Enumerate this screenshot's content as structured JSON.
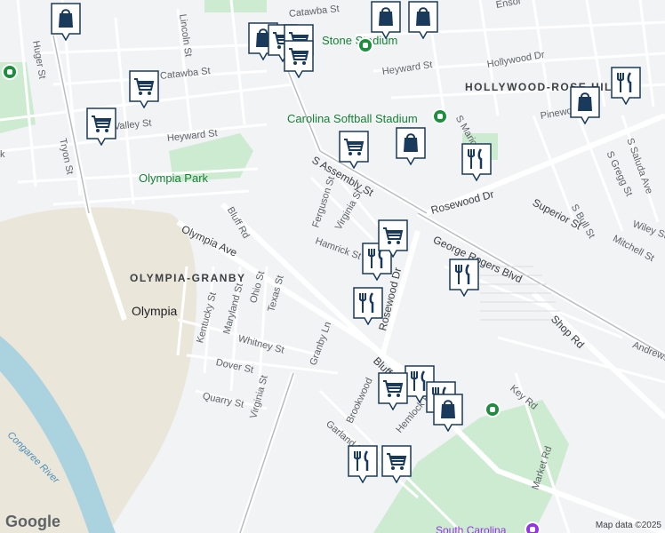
{
  "neighborhoods": [
    {
      "name": "OLYMPIA-GRANBY"
    },
    {
      "name": "HOLLYWOOD-ROSE HILL"
    }
  ],
  "city_label": "Olympia",
  "parks": [
    {
      "name": "Olympia Park"
    },
    {
      "name": "Carolina Softball Stadium"
    },
    {
      "name": "Stone Stadium"
    },
    {
      "name": "South Carolina"
    }
  ],
  "water": [
    {
      "name": "Congaree River"
    }
  ],
  "streets": [
    "Huger St",
    "Lincoln St",
    "Tryon St",
    "Heyward St",
    "S Assembly St",
    "Ferguson St",
    "Virginia St",
    "Hamrick St",
    "Bluff Rd",
    "Olympia Ave",
    "Ohio St",
    "Texas St",
    "Maryland St",
    "Kentucky St",
    "Whitney St",
    "Dover St",
    "Quarry St",
    "Virginia St",
    "Granby Ln",
    "Rosewood Dr",
    "Rosewood Dr",
    "George Rogers Blvd",
    "Superior St",
    "S Bull St",
    "S Gregg St",
    "S Saluda Ave",
    "Mitchell St",
    "Shop Rd",
    "Andrews",
    "Key Rd",
    "Market Rd",
    "Garland St",
    "Brookwood",
    "Hemlock Rd",
    "Heyward St",
    "Hollywood Dr",
    "S Marion St",
    "Pinewood",
    "Wiley St",
    "Catawba St",
    "Catawba St",
    "Ensor",
    "Valley St",
    "Bluff",
    "Bluff"
  ],
  "markers": [
    {
      "type": "shopping-bag"
    },
    {
      "type": "shopping-bag"
    },
    {
      "type": "shopping-cart"
    },
    {
      "type": "shopping-cart"
    },
    {
      "type": "shopping-cart"
    },
    {
      "type": "shopping-cart"
    },
    {
      "type": "shopping-cart"
    },
    {
      "type": "shopping-bag"
    },
    {
      "type": "shopping-bag"
    },
    {
      "type": "shopping-cart"
    },
    {
      "type": "shopping-bag"
    },
    {
      "type": "restaurant"
    },
    {
      "type": "shopping-bag"
    },
    {
      "type": "restaurant"
    },
    {
      "type": "restaurant"
    },
    {
      "type": "restaurant"
    },
    {
      "type": "restaurant"
    },
    {
      "type": "shopping-cart"
    },
    {
      "type": "restaurant"
    },
    {
      "type": "shopping-cart"
    },
    {
      "type": "restaurant"
    },
    {
      "type": "restaurant"
    },
    {
      "type": "shopping-cart"
    },
    {
      "type": "shopping-bag"
    }
  ],
  "branding": {
    "logo": "Google",
    "attribution": "Map data ©2025"
  },
  "colors": {
    "water": "#aad3df",
    "park": "#cdebd0",
    "pin": "#1a3a5c",
    "poi_green": "#1e8e3e"
  }
}
